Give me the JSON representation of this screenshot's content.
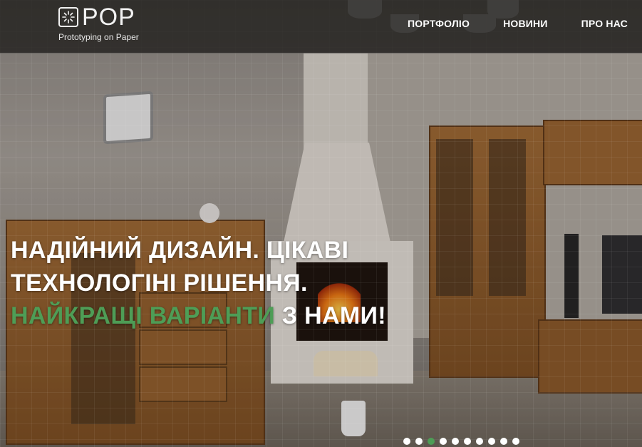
{
  "header": {
    "logo": {
      "wordmark": "POP",
      "tagline": "Prototyping on Paper"
    },
    "nav": [
      {
        "label": "ПОРТФОЛІО"
      },
      {
        "label": "НОВИНИ"
      },
      {
        "label": "ПРО НАС"
      }
    ]
  },
  "hero": {
    "headline_line1": "НАДІЙНИЙ ДИЗАЙН. ЦІКАВІ",
    "headline_line2": "ТЕХНОЛОГІНІ РІШЕННЯ.",
    "headline_accent": "НАЙКРАЩІ ВАРІАНТИ",
    "headline_tail": " З НАМИ!",
    "accent_color": "#4e9d56"
  },
  "carousel": {
    "slide_count": 10,
    "active_index": 2
  }
}
